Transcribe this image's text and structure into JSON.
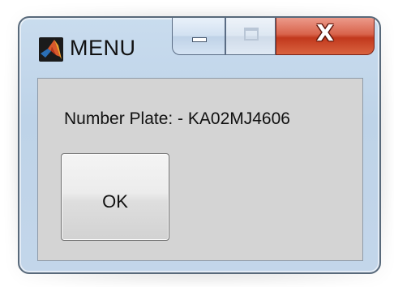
{
  "window": {
    "title": "MENU",
    "app_icon": "matlab-logo-icon",
    "controls": {
      "minimize_icon": "minimize-icon",
      "maximize_icon": "maximize-icon",
      "close_icon": "close-icon",
      "close_glyph": "X",
      "close_color": "#c7432a"
    }
  },
  "dialog": {
    "message": "Number Plate: -  KA02MJ4606",
    "ok_label": "OK",
    "background_color": "#d4d4d4"
  }
}
